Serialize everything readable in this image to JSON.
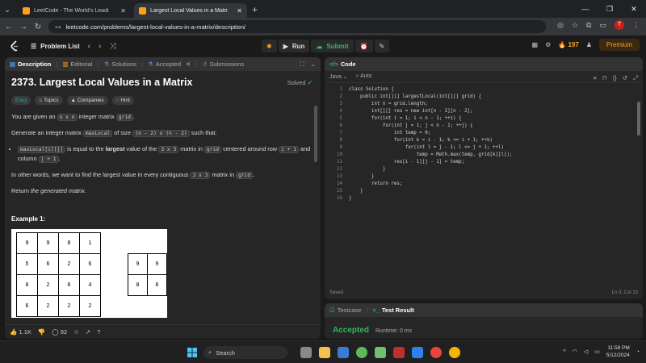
{
  "browser": {
    "tabs": [
      {
        "title": "LeetCode - The World's Leadi",
        "active": false
      },
      {
        "title": "Largest Local Values in a Matri",
        "active": true
      }
    ],
    "url": "leetcode.com/problems/largest-local-values-in-a-matrix/description/",
    "profile_initial": "T"
  },
  "header": {
    "problem_list": "Problem List",
    "run": "Run",
    "submit": "Submit",
    "streak": "197",
    "premium": "Premium"
  },
  "left_tabs": [
    "Description",
    "Editorial",
    "Solutions",
    "Accepted",
    "Submissions"
  ],
  "problem": {
    "title": "2373. Largest Local Values in a Matrix",
    "status": "Solved",
    "tags": [
      "Easy",
      "Topics",
      "Companies",
      "Hint"
    ],
    "p1_pre": "You are given an ",
    "p1_code1": "n x n",
    "p1_mid": " integer matrix ",
    "p1_code2": "grid",
    "p1_post": ".",
    "p2_pre": "Generate an integer matrix ",
    "p2_code1": "maxLocal",
    "p2_mid": " of size ",
    "p2_code2": "(n - 2) x (n - 2)",
    "p2_post": " such that:",
    "li_code1": "maxLocal[i][j]",
    "li_t1": " is equal to the ",
    "li_bold": "largest",
    "li_t2": " value of the ",
    "li_code2": "3 x 3",
    "li_t3": " matrix in ",
    "li_code3": "grid",
    "li_t4": " centered around row ",
    "li_code4": "i + 1",
    "li_t5": " and column ",
    "li_code5": "j + 1",
    "li_t6": ".",
    "p3_pre": "In other words, we want to find the largest value in every contiguous ",
    "p3_code1": "3 x 3",
    "p3_mid": " matrix in ",
    "p3_code2": "grid",
    "p3_post": ".",
    "p4_pre": "Return ",
    "p4_em": "the generated matrix",
    "p4_post": ".",
    "example_title": "Example 1:",
    "grid_in": [
      [
        "9",
        "9",
        "8",
        "1"
      ],
      [
        "5",
        "6",
        "2",
        "6"
      ],
      [
        "8",
        "2",
        "6",
        "4"
      ],
      [
        "6",
        "2",
        "2",
        "2"
      ]
    ],
    "grid_out": [
      [
        "9",
        "9"
      ],
      [
        "8",
        "6"
      ]
    ]
  },
  "left_footer": {
    "likes": "1.1K",
    "comments": "92"
  },
  "code": {
    "tab": "Code",
    "language": "Java",
    "mode": "Auto",
    "lines": [
      "class Solution {",
      "    public int[][] largestLocal(int[][] grid) {",
      "        int n = grid.length;",
      "        int[][] res = new int[n - 2][n - 2];",
      "        for(int i = 1; i < n - 1; ++i) {",
      "            for(int j = 1; j < n - 1; ++j) {",
      "                int temp = 0;",
      "                for(int k = i - 1; k <= i + 1; ++k)",
      "                    for(int l = j - 1; l <= j + 1; ++l)",
      "                        temp = Math.max(temp, grid[k][l]);",
      "                res[i - 1][j - 1] = temp;",
      "            }",
      "        }",
      "        return res;",
      "    }",
      "}"
    ],
    "saved": "Saved",
    "cursor": "Ln 3, Col 13"
  },
  "test": {
    "tab_testcase": "Testcase",
    "tab_result": "Test Result",
    "verdict": "Accepted",
    "runtime": "Runtime: 0 ms"
  },
  "taskbar": {
    "search": "Search",
    "time": "11:58 PM",
    "date": "5/12/2024"
  },
  "colors": {
    "accent": "#ffa116",
    "success": "#2cbb5d",
    "easy": "#00b8a3"
  }
}
